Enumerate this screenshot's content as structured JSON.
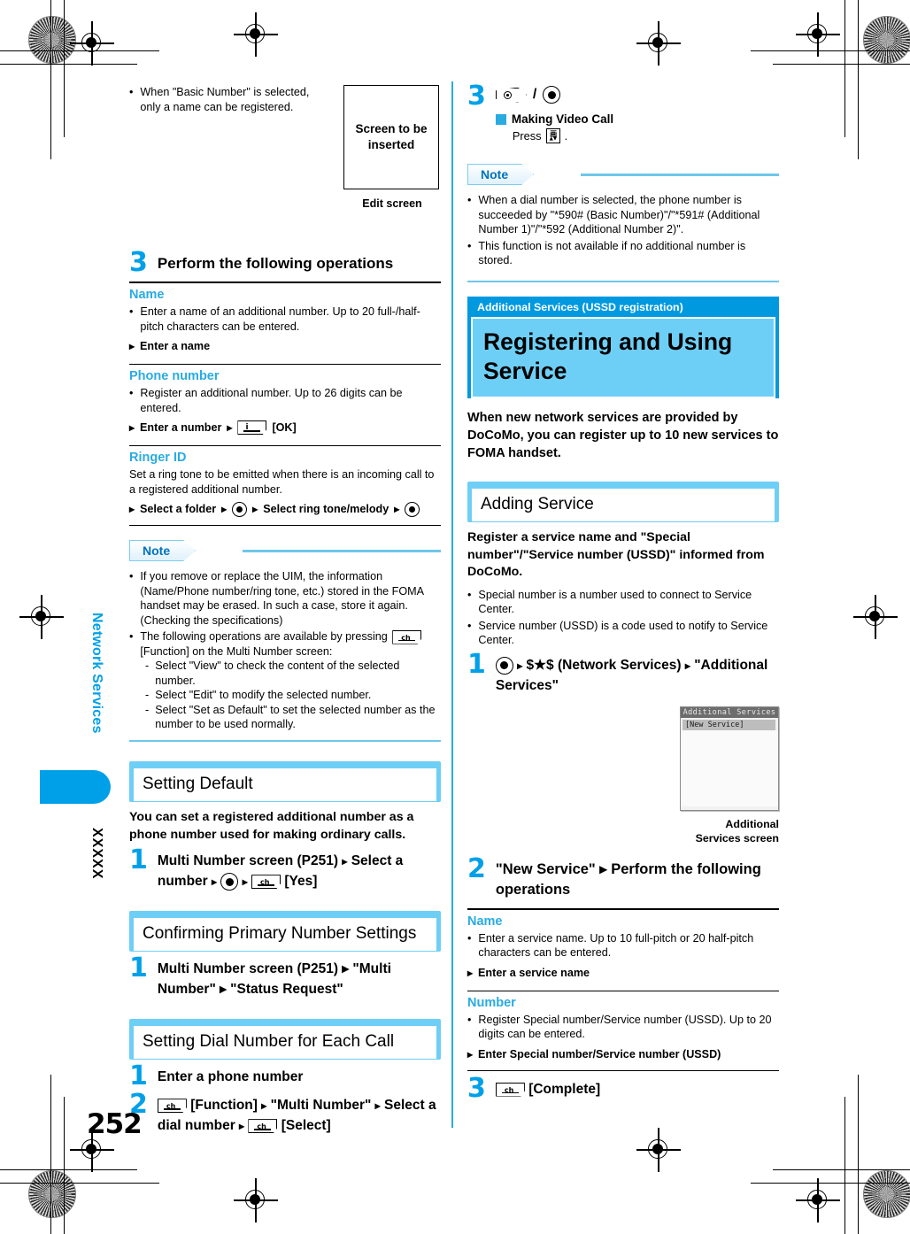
{
  "page": {
    "number": "252",
    "chapter_tab": "Network Services",
    "section_tab": "XXXXX",
    "accent_color": "#00a0e9",
    "heading_color": "#29abe2",
    "band_color": "#6ecff6"
  },
  "left_column": {
    "intro_bullet": "When \"Basic Number\" is selected, only a name can be registered.",
    "edit_screen": {
      "placeholder_text": "Screen to be inserted",
      "caption": "Edit screen"
    },
    "step3": {
      "num": "3",
      "text": "Perform the following operations"
    },
    "fields": [
      {
        "name": "Name",
        "desc": "Enter a name of an additional number. Up to 20 full-/half-pitch characters can be entered.",
        "action": "Enter a name"
      },
      {
        "name": "Phone number",
        "desc": "Register an additional number. Up to 26 digits can be entered.",
        "action_a": "Enter a number",
        "action_b": "[OK]"
      },
      {
        "name": "Ringer ID",
        "desc": "Set a ring tone to be emitted when there is an incoming call to a registered additional number.",
        "action_a": "Select a folder",
        "action_b": "Select ring tone/melody"
      }
    ],
    "note": {
      "label": "Note",
      "bullets": [
        "If you remove or replace the UIM, the information (Name/Phone number/ring tone, etc.) stored in the FOMA handset may be erased. In such a case, store it again. (Checking the specifications)"
      ],
      "bullet2_pre": "The following operations are available by pressing",
      "bullet2_post": "[Function] on the Multi Number screen:",
      "dashes": [
        "Select \"View\" to check the content of the selected number.",
        "Select \"Edit\" to modify the selected number.",
        "Select \"Set as Default\" to set the selected number as the number to be used normally."
      ]
    },
    "sections": [
      {
        "title": "Setting Default",
        "intro": "You can set a registered additional number as a phone number used for making ordinary calls.",
        "step_num": "1",
        "step_a": "Multi Number screen (P251)",
        "step_b": "Select a number",
        "step_c": "[Yes]"
      },
      {
        "title": "Confirming Primary Number Settings",
        "step_num": "1",
        "step_text": "Multi Number screen (P251) ▸ \"Multi Number\" ▸ \"Status Request\""
      },
      {
        "title": "Setting Dial Number for Each Call",
        "step1_num": "1",
        "step1_text": "Enter a phone number",
        "step2_num": "2",
        "step2_a": "[Function]",
        "step2_b": "\"Multi Number\"",
        "step2_c": "Select a dial number",
        "step2_d": "[Select]"
      }
    ]
  },
  "right_column": {
    "step3": {
      "num": "3",
      "sub_head": "Making Video Call",
      "press_label": "Press",
      "press_suffix": "."
    },
    "note": {
      "label": "Note",
      "bullets": [
        "When a dial number is selected, the phone number is succeeded by \"*590# (Basic Number)\"/\"*591# (Additional Number 1)\"/\"*592 (Additional Number 2)\".",
        "This function is not available if no additional number is stored."
      ]
    },
    "chapter_title": {
      "eyebrow": "Additional Services (USSD registration)",
      "title": "Registering and Using Service",
      "intro": "When new network services are provided by DoCoMo, you can register up to 10 new services to FOMA handset."
    },
    "adding_service": {
      "title": "Adding Service",
      "intro": "Register a service name and \"Special number\"/\"Service number (USSD)\" informed from DoCoMo.",
      "bullets": [
        "Special number is a number used to connect to Service Center.",
        "Service number (USSD) is a code used to notify to Service Center."
      ],
      "step1_num": "1",
      "step1_a": "$★$ (Network Services)",
      "step1_b": "\"Additional Services\"",
      "phone_screen": {
        "title": "Additional Services",
        "item": "[New Service]",
        "caption_line1": "Additional",
        "caption_line2": "Services screen"
      },
      "step2_num": "2",
      "step2_text": "\"New Service\" ▸ Perform the following operations",
      "fields": [
        {
          "name": "Name",
          "desc": "Enter a service name. Up to 10 full-pitch or 20 half-pitch characters can be entered.",
          "action": "Enter a service name"
        },
        {
          "name": "Number",
          "desc": "Register Special number/Service number (USSD). Up to 20 digits can be entered.",
          "action": "Enter Special number/Service number (USSD)"
        }
      ],
      "step3_num": "3",
      "step3_text": "[Complete]"
    }
  },
  "icons": {
    "center_key": "center-select-key-icon",
    "soft_key_ch": "ch-soft-key-icon",
    "soft_key_ok": "ok-soft-key-icon",
    "call_key": "voice-call-key-icon",
    "videocall_key": "video-call-key-icon"
  }
}
